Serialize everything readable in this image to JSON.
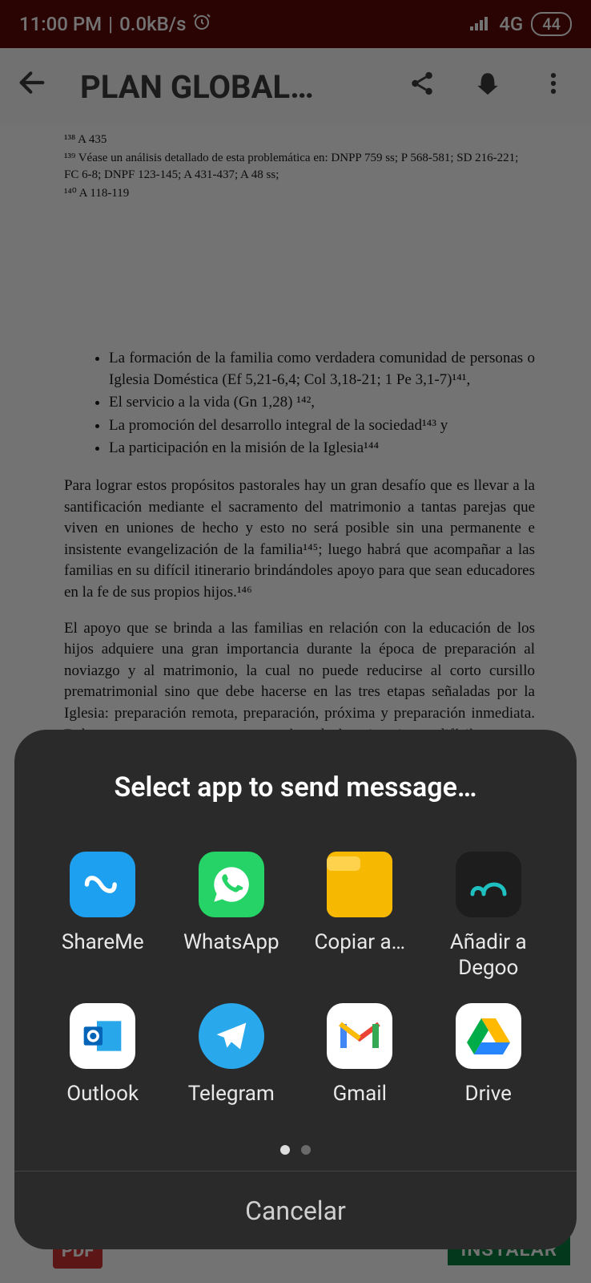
{
  "status": {
    "time": "11:00 PM",
    "speed": "0.0kB/s",
    "network": "4G",
    "battery": "44"
  },
  "header": {
    "title": "PLAN GLOBAL…"
  },
  "doc": {
    "fn1": "¹³⁸ A 435",
    "fn2": "¹³⁹ Véase un análisis detallado de esta problemática en: DNPP 759 ss; P 568-581; SD 216-221; FC 6-8; DNPF 123-145; A 431-437; A 48 ss;",
    "fn3": "¹⁴⁰ A 118-119",
    "li1": "La formación de la familia como verdadera comunidad de personas o Iglesia Doméstica (Ef 5,21-6,4; Col 3,18-21; 1 Pe 3,1-7)¹⁴¹,",
    "li2": "El servicio a la vida (Gn 1,28) ¹⁴²,",
    "li3": "La promoción del desarrollo integral de la sociedad¹⁴³ y",
    "li4": "La participación en la misión de la Iglesia¹⁴⁴",
    "p1": "Para lograr estos propósitos pastorales hay un gran desafío que es llevar a la santificación mediante el sacramento del matrimonio a tantas parejas que viven en uniones de hecho y esto no será posible sin una permanente e insistente evangelización de la familia¹⁴⁵; luego habrá que acompañar a las familias en su difícil itinerario brindándoles apoyo para que sean educadores en la fe de sus propios hijos.¹⁴⁶",
    "p2": "El apoyo que se brinda a las familias en relación con la educación de los hijos adquiere una gran importancia durante la época de preparación al noviazgo y al matrimonio, la cual no puede reducirse al corto cursillo prematrimonial sino que debe hacerse en las tres etapas señaladas por la Iglesia: preparación remota, preparación, próxima y preparación inmediata. Debemos tener en cuenta que muchas de las situaciones difíciles que se viven en la familia se deben en gran parte a fallas en la preparación para el noviazgo, la afectividad y el matrimonio y por tanto"
  },
  "install": {
    "badge": "PDF",
    "button": "INSTALAR"
  },
  "sheet": {
    "title": "Select app to send message…",
    "apps": [
      {
        "label": "ShareMe"
      },
      {
        "label": "WhatsApp"
      },
      {
        "label": "Copiar a…"
      },
      {
        "label": "Añadir a Degoo"
      },
      {
        "label": "Outlook"
      },
      {
        "label": "Telegram"
      },
      {
        "label": "Gmail"
      },
      {
        "label": "Drive"
      }
    ],
    "cancel": "Cancelar"
  }
}
